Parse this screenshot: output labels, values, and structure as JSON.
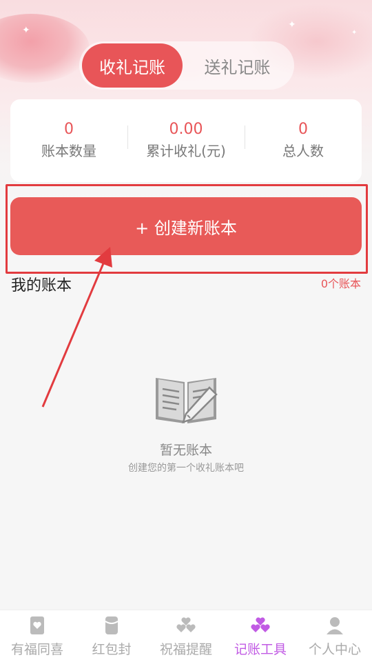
{
  "tabs": [
    {
      "label": "收礼记账",
      "active": true
    },
    {
      "label": "送礼记账",
      "active": false
    }
  ],
  "stats": [
    {
      "value": "0",
      "label": "账本数量"
    },
    {
      "value": "0.00",
      "label": "累计收礼(元)"
    },
    {
      "value": "0",
      "label": "总人数"
    }
  ],
  "create_button": {
    "label": "+ 创建新账本"
  },
  "section": {
    "title": "我的账本",
    "count": "0个账本"
  },
  "empty": {
    "title": "暂无账本",
    "subtitle": "创建您的第一个收礼账本吧",
    "icon": "book-pen-icon"
  },
  "nav": [
    {
      "label": "有福同喜",
      "icon": "card-heart-icon",
      "active": false
    },
    {
      "label": "红包封",
      "icon": "envelope-icon",
      "active": false
    },
    {
      "label": "祝福提醒",
      "icon": "hearts-icon",
      "active": false
    },
    {
      "label": "记账工具",
      "icon": "hearts-icon",
      "active": true
    },
    {
      "label": "个人中心",
      "icon": "person-icon",
      "active": false
    }
  ],
  "colors": {
    "accent": "#e85558",
    "nav_active": "#c15be4",
    "annotation": "#e23b3f"
  }
}
